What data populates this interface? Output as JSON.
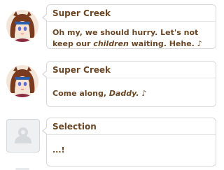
{
  "messages": [
    {
      "speaker": "Super Creek",
      "avatar": "super-creek-portrait",
      "text_parts": [
        "Oh my, we should hurry. Let's not keep our ",
        "children",
        " waiting. Hehe. ♪"
      ]
    },
    {
      "speaker": "Super Creek",
      "avatar": "super-creek-portrait",
      "text_parts": [
        "Come along, ",
        "Daddy.",
        " ♪"
      ]
    },
    {
      "speaker": "Selection",
      "avatar": "placeholder-icon",
      "text": "...!"
    }
  ],
  "colors": {
    "text": "#6a4624",
    "bubble_border": "#d9d9d9",
    "hair": "#7a3a1e",
    "eyes": "#5b6fd0",
    "headband": "#2d5fa8"
  }
}
